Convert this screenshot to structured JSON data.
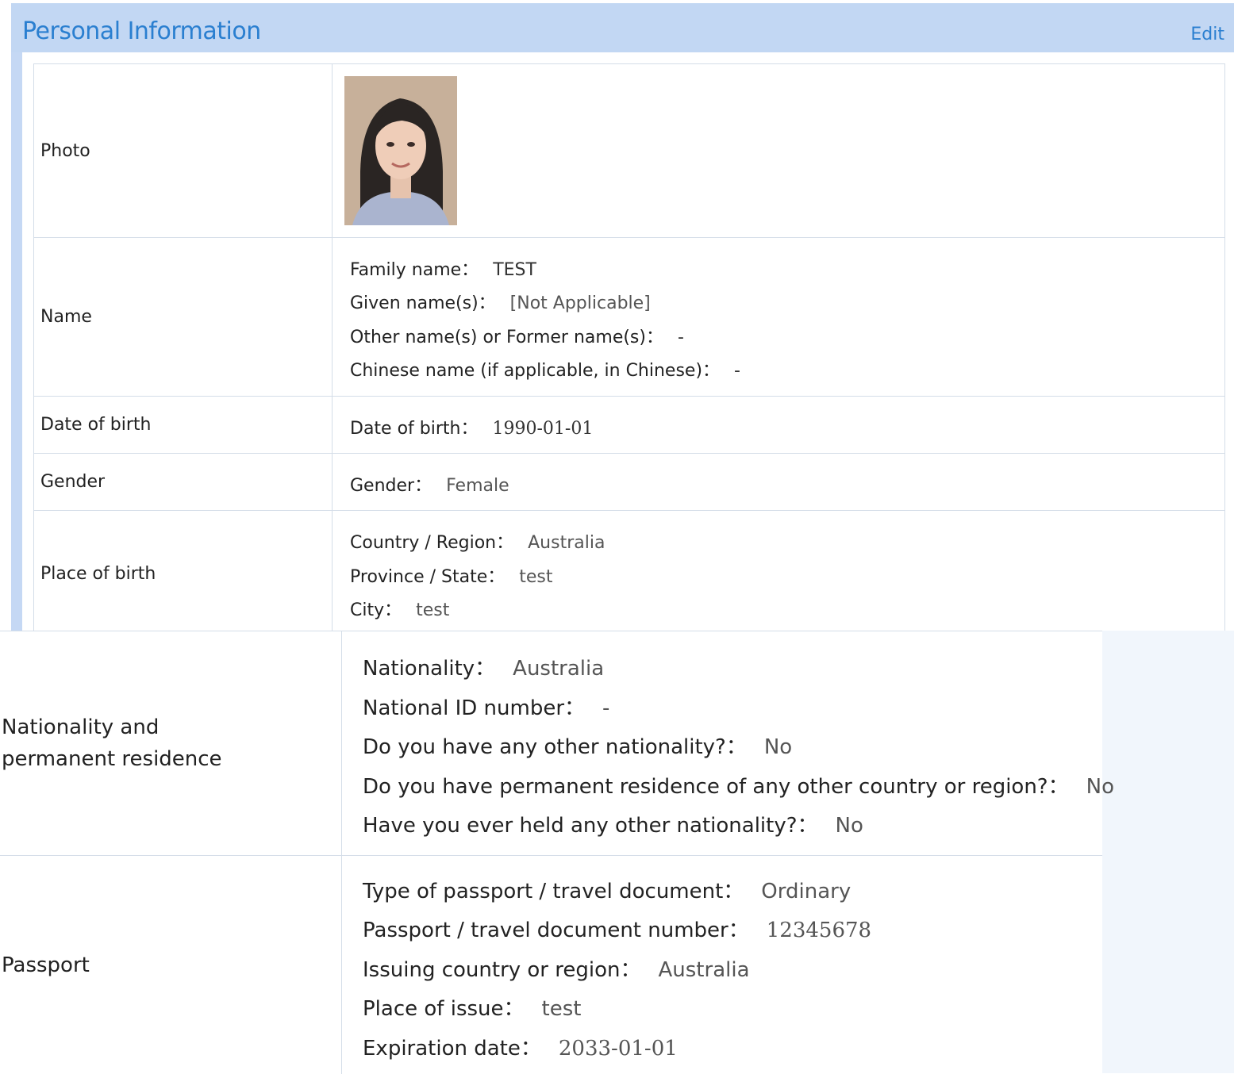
{
  "header": {
    "title": "Personal Information",
    "edit_label": "Edit"
  },
  "labels": {
    "photo": "Photo",
    "name": "Name",
    "dob": "Date of birth",
    "gender": "Gender",
    "place_of_birth": "Place of birth",
    "nationality": "Nationality and permanent residence",
    "passport": "Passport"
  },
  "name": {
    "family_k": "Family name：",
    "family_v": "TEST",
    "given_k": "Given name(s)：",
    "given_v": "[Not Applicable]",
    "other_k": "Other name(s) or Former name(s)：",
    "other_v": "-",
    "chinese_k": "Chinese name (if applicable, in Chinese)：",
    "chinese_v": "-"
  },
  "dob": {
    "k": "Date of birth：",
    "v": "1990-01-01"
  },
  "gender": {
    "k": "Gender：",
    "v": "Female"
  },
  "birthplace": {
    "country_k": "Country / Region：",
    "country_v": "Australia",
    "province_k": "Province / State：",
    "province_v": "test",
    "city_k": "City：",
    "city_v": "test"
  },
  "nationality": {
    "nat_k": "Nationality：",
    "nat_v": "Australia",
    "id_k": "National ID number：",
    "id_v": "-",
    "other_nat_k": "Do you have any other nationality?：",
    "other_nat_v": "No",
    "perm_k": "Do you have permanent residence of any other country or region?：",
    "perm_v": "No",
    "held_k": "Have you ever held any other nationality?：",
    "held_v": "No"
  },
  "passport": {
    "type_k": "Type of passport / travel document：",
    "type_v": "Ordinary",
    "number_k": "Passport / travel document number：",
    "number_v": "12345678",
    "country_k": "Issuing country or region：",
    "country_v": "Australia",
    "place_k": "Place of issue：",
    "place_v": "test",
    "expiry_k": "Expiration date：",
    "expiry_v": "2033-01-01"
  },
  "colors": {
    "header_bg": "#c2d7f3",
    "accent": "#2a7fd0",
    "border": "#d4dde8"
  }
}
